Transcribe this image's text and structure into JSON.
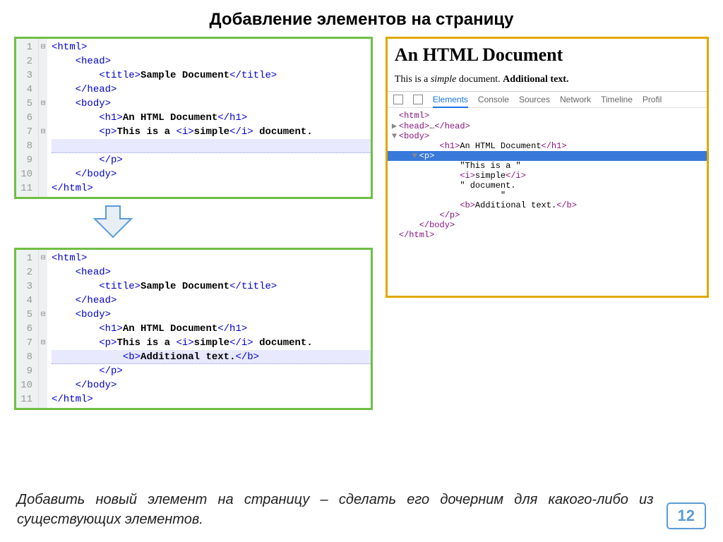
{
  "title": "Добавление элементов на страницу",
  "editor1": {
    "lines": [
      "1",
      "2",
      "3",
      "4",
      "5",
      "6",
      "7",
      "8",
      "9",
      "10",
      "11"
    ],
    "folds": [
      "⊟",
      "",
      "",
      "",
      "⊟",
      "",
      "⊟",
      "",
      "",
      "",
      ""
    ],
    "code": [
      [
        {
          "t": "tag",
          "v": "<html>"
        }
      ],
      [
        {
          "t": "sp",
          "v": "    "
        },
        {
          "t": "tag",
          "v": "<head>"
        }
      ],
      [
        {
          "t": "sp",
          "v": "        "
        },
        {
          "t": "tag",
          "v": "<title>"
        },
        {
          "t": "txt",
          "v": "Sample Document"
        },
        {
          "t": "tag",
          "v": "</title>"
        }
      ],
      [
        {
          "t": "sp",
          "v": "    "
        },
        {
          "t": "tag",
          "v": "</head>"
        }
      ],
      [
        {
          "t": "sp",
          "v": "    "
        },
        {
          "t": "tag",
          "v": "<body>"
        }
      ],
      [
        {
          "t": "sp",
          "v": "        "
        },
        {
          "t": "tag",
          "v": "<h1>"
        },
        {
          "t": "txt",
          "v": "An HTML Document"
        },
        {
          "t": "tag",
          "v": "</h1>"
        }
      ],
      [
        {
          "t": "sp",
          "v": "        "
        },
        {
          "t": "tag",
          "v": "<p>"
        },
        {
          "t": "txt",
          "v": "This is a "
        },
        {
          "t": "tag",
          "v": "<i>"
        },
        {
          "t": "txt",
          "v": "simple"
        },
        {
          "t": "tag",
          "v": "</i>"
        },
        {
          "t": "txt",
          "v": " document."
        }
      ],
      [
        {
          "t": "sp",
          "v": "            "
        }
      ],
      [
        {
          "t": "sp",
          "v": "        "
        },
        {
          "t": "tag",
          "v": "</p>"
        }
      ],
      [
        {
          "t": "sp",
          "v": "    "
        },
        {
          "t": "tag",
          "v": "</body>"
        }
      ],
      [
        {
          "t": "tag",
          "v": "</html>"
        }
      ]
    ],
    "hl_index": 7
  },
  "editor2": {
    "lines": [
      "1",
      "2",
      "3",
      "4",
      "5",
      "6",
      "7",
      "8",
      "9",
      "10",
      "11"
    ],
    "folds": [
      "⊟",
      "",
      "",
      "",
      "⊟",
      "",
      "⊟",
      "",
      "",
      "",
      ""
    ],
    "code": [
      [
        {
          "t": "tag",
          "v": "<html>"
        }
      ],
      [
        {
          "t": "sp",
          "v": "    "
        },
        {
          "t": "tag",
          "v": "<head>"
        }
      ],
      [
        {
          "t": "sp",
          "v": "        "
        },
        {
          "t": "tag",
          "v": "<title>"
        },
        {
          "t": "txt",
          "v": "Sample Document"
        },
        {
          "t": "tag",
          "v": "</title>"
        }
      ],
      [
        {
          "t": "sp",
          "v": "    "
        },
        {
          "t": "tag",
          "v": "</head>"
        }
      ],
      [
        {
          "t": "sp",
          "v": "    "
        },
        {
          "t": "tag",
          "v": "<body>"
        }
      ],
      [
        {
          "t": "sp",
          "v": "        "
        },
        {
          "t": "tag",
          "v": "<h1>"
        },
        {
          "t": "txt",
          "v": "An HTML Document"
        },
        {
          "t": "tag",
          "v": "</h1>"
        }
      ],
      [
        {
          "t": "sp",
          "v": "        "
        },
        {
          "t": "tag",
          "v": "<p>"
        },
        {
          "t": "txt",
          "v": "This is a "
        },
        {
          "t": "tag",
          "v": "<i>"
        },
        {
          "t": "txt",
          "v": "simple"
        },
        {
          "t": "tag",
          "v": "</i>"
        },
        {
          "t": "txt",
          "v": " document."
        }
      ],
      [
        {
          "t": "sp",
          "v": "            "
        },
        {
          "t": "tag",
          "v": "<b>"
        },
        {
          "t": "txt",
          "v": "Additional text."
        },
        {
          "t": "tag",
          "v": "</b>"
        }
      ],
      [
        {
          "t": "sp",
          "v": "        "
        },
        {
          "t": "tag",
          "v": "</p>"
        }
      ],
      [
        {
          "t": "sp",
          "v": "    "
        },
        {
          "t": "tag",
          "v": "</body>"
        }
      ],
      [
        {
          "t": "tag",
          "v": "</html>"
        }
      ]
    ],
    "hl_index": 7
  },
  "output": {
    "heading": "An HTML Document",
    "para_prefix": "This is a ",
    "para_italic": "simple",
    "para_mid": " document. ",
    "para_bold": "Additional text."
  },
  "devtools": {
    "tabs": [
      "Elements",
      "Console",
      "Sources",
      "Network",
      "Timeline",
      "Profil"
    ],
    "active": 0,
    "dom": [
      {
        "indent": 0,
        "pre": "",
        "content": [
          {
            "t": "dt",
            "v": "<html>"
          }
        ]
      },
      {
        "indent": 0,
        "pre": "▶ ",
        "content": [
          {
            "t": "dt",
            "v": "<head>"
          },
          {
            "t": "str",
            "v": "…"
          },
          {
            "t": "dt",
            "v": "</head>"
          }
        ]
      },
      {
        "indent": 0,
        "pre": "▼ ",
        "content": [
          {
            "t": "dt",
            "v": "<body>"
          }
        ]
      },
      {
        "indent": 2,
        "pre": "",
        "content": [
          {
            "t": "dt",
            "v": "<h1>"
          },
          {
            "t": "str",
            "v": "An HTML Document"
          },
          {
            "t": "dt",
            "v": "</h1>"
          }
        ]
      },
      {
        "indent": 1,
        "pre": "▼ ",
        "content": [
          {
            "t": "dt",
            "v": "<p>"
          }
        ],
        "sel": true
      },
      {
        "indent": 3,
        "pre": "",
        "content": [
          {
            "t": "str",
            "v": "\"This is a \""
          }
        ]
      },
      {
        "indent": 3,
        "pre": "",
        "content": [
          {
            "t": "dt",
            "v": "<i>"
          },
          {
            "t": "str",
            "v": "simple"
          },
          {
            "t": "dt",
            "v": "</i>"
          }
        ]
      },
      {
        "indent": 3,
        "pre": "",
        "content": [
          {
            "t": "str",
            "v": "\" document."
          }
        ]
      },
      {
        "indent": 3,
        "pre": "",
        "content": [
          {
            "t": "str",
            "v": "        \""
          }
        ]
      },
      {
        "indent": 3,
        "pre": "",
        "content": [
          {
            "t": "dt",
            "v": "<b>"
          },
          {
            "t": "str",
            "v": "Additional text."
          },
          {
            "t": "dt",
            "v": "</b>"
          }
        ]
      },
      {
        "indent": 2,
        "pre": "",
        "content": [
          {
            "t": "dt",
            "v": "</p>"
          }
        ]
      },
      {
        "indent": 1,
        "pre": "",
        "content": [
          {
            "t": "dt",
            "v": "</body>"
          }
        ]
      },
      {
        "indent": 0,
        "pre": "",
        "content": [
          {
            "t": "dt",
            "v": "</html>"
          }
        ]
      }
    ]
  },
  "caption": "Добавить новый элемент на страницу – сделать его дочерним для какого‑либо из существующих элементов.",
  "page_num": "12"
}
